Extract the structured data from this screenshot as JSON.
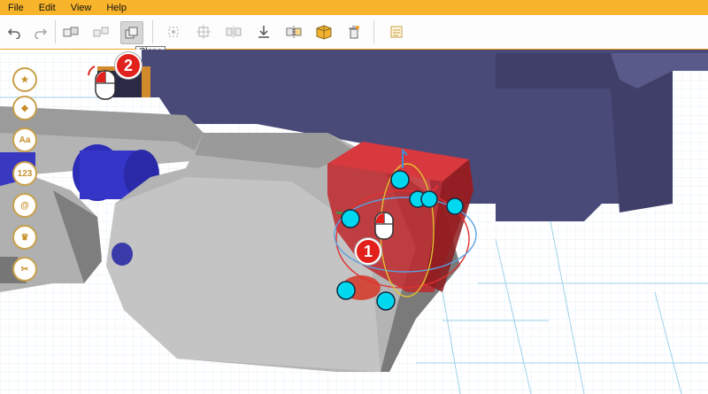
{
  "menu": {
    "file": "File",
    "edit": "Edit",
    "view": "View",
    "help": "Help"
  },
  "toolbar": {
    "icons": [
      "undo-icon",
      "redo-icon",
      "group-icon",
      "ungroup-icon",
      "clone-icon",
      "align-icon",
      "distribute-icon",
      "mirror-icon",
      "drop-to-plane-icon",
      "split-icon",
      "box-icon",
      "delete-icon",
      "notes-icon"
    ],
    "tooltip": "Clone"
  },
  "sidebar": {
    "items": [
      {
        "name": "favorites",
        "glyph": "★"
      },
      {
        "name": "shapes",
        "glyph": "◆"
      },
      {
        "name": "text",
        "glyph": "Aa"
      },
      {
        "name": "numbers",
        "glyph": "123"
      },
      {
        "name": "symbols",
        "glyph": "@"
      },
      {
        "name": "premium",
        "glyph": "♛"
      },
      {
        "name": "tools",
        "glyph": "✂"
      }
    ]
  },
  "annotations": {
    "step1": "1",
    "step2": "2"
  },
  "colors": {
    "menubar": "#f8b42a",
    "callout": "#e2211c",
    "handle": "#00d8f0",
    "selected_part": "#c0282d",
    "chain_link": "#b4b4b4",
    "chain_pin": "#3535c8",
    "body": "#4a4a78"
  }
}
